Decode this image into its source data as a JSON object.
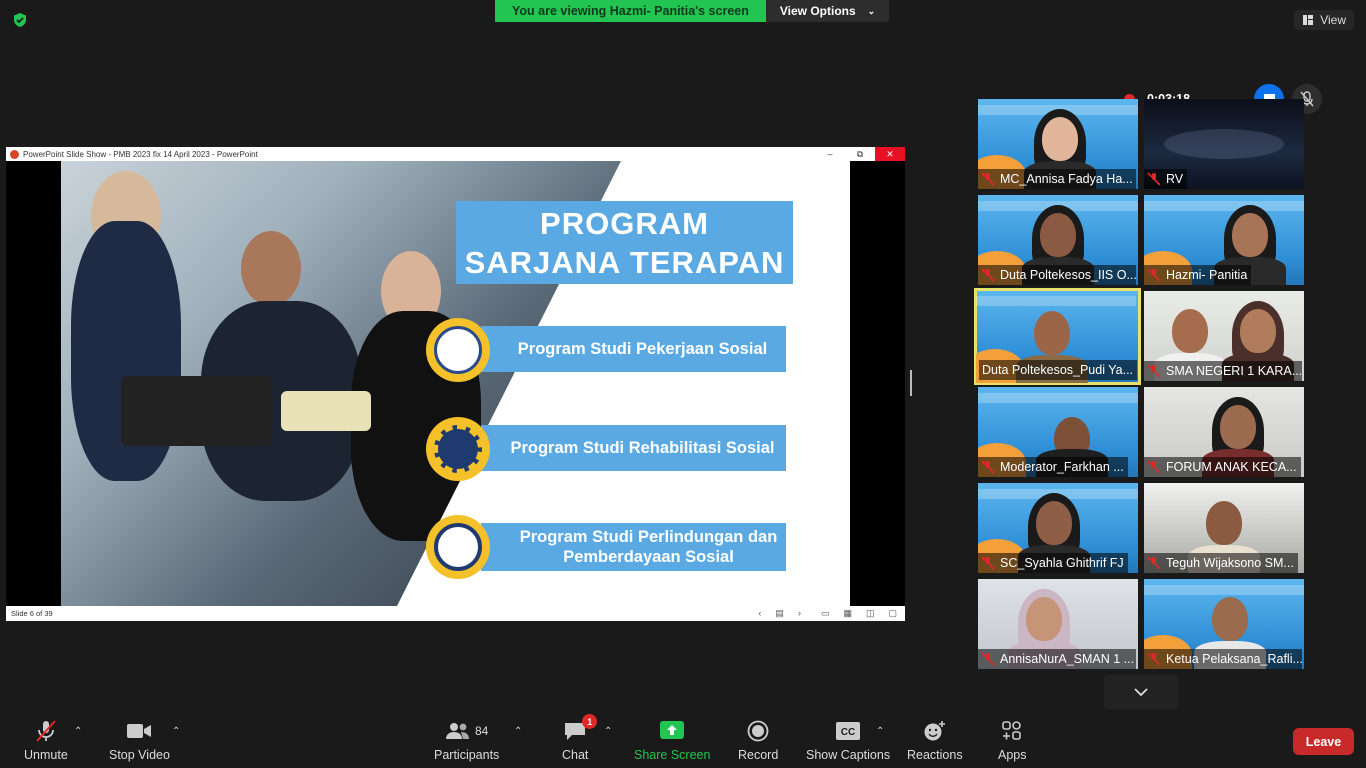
{
  "banner": {
    "viewing": "You are viewing Hazmi- Panitia's screen",
    "view_options": "View Options"
  },
  "view_button": "View",
  "ppt": {
    "window_title": "PowerPoint Slide Show  -  PMB 2023 fix 14 April 2023 - PowerPoint",
    "status": "Slide 6 of 39",
    "slide_title_line1": "PROGRAM",
    "slide_title_line2": "SARJANA TERAPAN",
    "programs": [
      "Program Studi Pekerjaan Sosial",
      "Program Studi Rehabilitasi Sosial",
      "Program Studi Perlindungan dan Pemberdayaan Sosial"
    ]
  },
  "recording": {
    "time": "0:03:18"
  },
  "participants_tiles": [
    {
      "name": "MC_Annisa Fadya Ha..."
    },
    {
      "name": "RV"
    },
    {
      "name": "Duta Poltekesos_IIS O..."
    },
    {
      "name": "Hazmi- Panitia"
    },
    {
      "name": "Duta Poltekesos_Pudi Ya..."
    },
    {
      "name": "SMA NEGERI 1 KARA..."
    },
    {
      "name": "Moderator_Farkhan ..."
    },
    {
      "name": "FORUM ANAK KECA..."
    },
    {
      "name": "SC_Syahla Ghithrif FJ"
    },
    {
      "name": "Teguh Wijaksono SM..."
    },
    {
      "name": "AnnisaNurA_SMAN 1 ..."
    },
    {
      "name": "Ketua Pelaksana_Rafli..."
    }
  ],
  "toolbar": {
    "unmute": "Unmute",
    "stop_video": "Stop Video",
    "participants": "Participants",
    "participants_count": "84",
    "chat": "Chat",
    "chat_badge": "1",
    "share_screen": "Share Screen",
    "record": "Record",
    "show_captions": "Show Captions",
    "reactions": "Reactions",
    "apps": "Apps",
    "leave": "Leave"
  },
  "colors": {
    "accent_green": "#23c552",
    "accent_blue": "#0e72ed",
    "leave_red": "#c82a2a",
    "slide_blue": "#5ba9e3",
    "active_speaker": "#e9e26a"
  }
}
